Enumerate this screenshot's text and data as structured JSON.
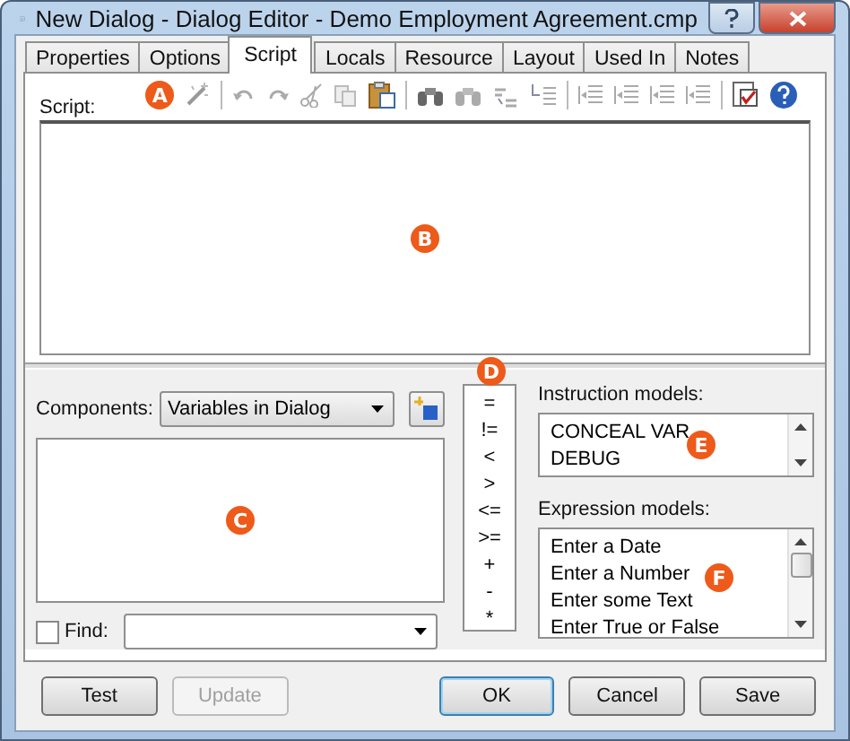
{
  "window": {
    "title": "New Dialog - Dialog Editor - Demo Employment Agreement.cmp"
  },
  "tabs": [
    {
      "label": "Properties",
      "selected": false
    },
    {
      "label": "Options",
      "selected": false
    },
    {
      "label": "Script",
      "selected": true
    },
    {
      "label": "Locals",
      "selected": false
    },
    {
      "label": "Resource",
      "selected": false
    },
    {
      "label": "Layout",
      "selected": false
    },
    {
      "label": "Used In",
      "selected": false
    },
    {
      "label": "Notes",
      "selected": false
    }
  ],
  "script": {
    "label": "Script:"
  },
  "components": {
    "label": "Components:",
    "dropdown": "Variables in Dialog"
  },
  "find": {
    "label": "Find:",
    "checked": false
  },
  "operators": [
    "=",
    "!=",
    "<",
    ">",
    "<=",
    ">=",
    "+",
    "-",
    "*"
  ],
  "instruction_models": {
    "label": "Instruction models:",
    "items": [
      "CONCEAL VAR",
      "DEBUG"
    ]
  },
  "expression_models": {
    "label": "Expression models:",
    "items": [
      "Enter a Date",
      "Enter a Number",
      "Enter some Text",
      "Enter True or False"
    ]
  },
  "callouts": [
    "A",
    "B",
    "C",
    "D",
    "E",
    "F"
  ],
  "buttons": [
    {
      "label": "Test",
      "disabled": false,
      "default": false
    },
    {
      "label": "Update",
      "disabled": true,
      "default": false
    },
    {
      "label": "OK",
      "disabled": false,
      "default": true
    },
    {
      "label": "Cancel",
      "disabled": false,
      "default": false
    },
    {
      "label": "Save",
      "disabled": false,
      "default": false
    }
  ]
}
